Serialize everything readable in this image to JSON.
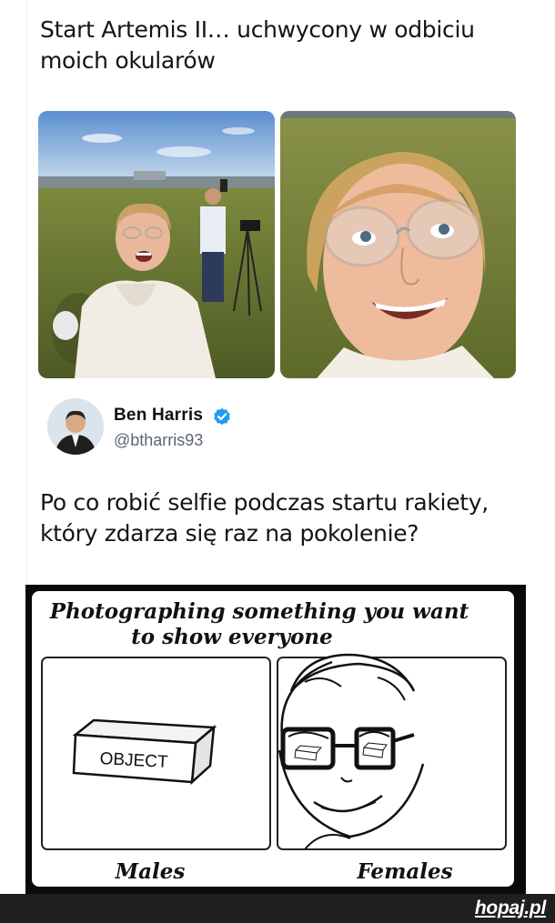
{
  "tweet": {
    "text": "Start Artemis II… uchwycony w odbiciu moich okularów"
  },
  "reply": {
    "author_name": "Ben Harris",
    "author_handle": "@btharris93",
    "text": "Po co robić selfie podczas startu rakiety, który zdarza się raz na pokolenie?"
  },
  "comic": {
    "title_line1": "Photographing something you want",
    "title_line2": "to show everyone",
    "object_label": "OBJECT",
    "left_caption": "Males",
    "right_caption": "Females"
  },
  "footer": {
    "logo": "hopaj.pl"
  },
  "icons": {
    "verified": "verified-badge-icon"
  },
  "colors": {
    "verified_blue": "#1d9bf0",
    "footer_bg": "#1f1f1f",
    "comic_frame": "#0a0a0a"
  }
}
